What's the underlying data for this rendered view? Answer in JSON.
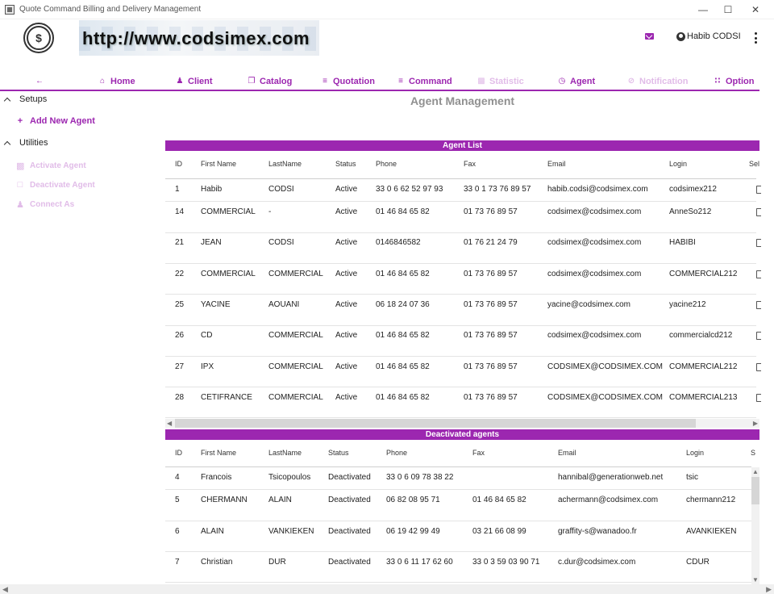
{
  "window": {
    "title": "Quote Command Billing and Delivery Management",
    "minimize": "—",
    "maximize": "☐",
    "close": "✕"
  },
  "header": {
    "banner_text": "http://www.codsimex.com",
    "user_name": "Habib CODSI",
    "logo_text": "$"
  },
  "nav": {
    "items": [
      {
        "label": "",
        "icon": "arrow-left-icon",
        "disabled": false
      },
      {
        "label": "Home",
        "icon": "home-icon",
        "disabled": false
      },
      {
        "label": "Client",
        "icon": "people-icon",
        "disabled": false
      },
      {
        "label": "Catalog",
        "icon": "catalog-icon",
        "disabled": false
      },
      {
        "label": "Quotation",
        "icon": "list-icon",
        "disabled": false
      },
      {
        "label": "Command",
        "icon": "list-icon",
        "disabled": false
      },
      {
        "label": "Statistic",
        "icon": "bar-chart-icon",
        "disabled": true
      },
      {
        "label": "Agent",
        "icon": "alarm-clock-icon",
        "disabled": false
      },
      {
        "label": "Notification",
        "icon": "bell-off-icon",
        "disabled": true
      },
      {
        "label": "Option",
        "icon": "grid-icon",
        "disabled": false
      }
    ]
  },
  "sidebar": {
    "setups_label": "Setups",
    "add_agent_label": "Add New Agent",
    "utilities_label": "Utilities",
    "activate_label": "Activate Agent",
    "deactivate_label": "Deactivate Agent",
    "connect_label": "Connect As"
  },
  "main": {
    "title": "Agent Management"
  },
  "agent_list": {
    "title": "Agent List",
    "columns": [
      "ID",
      "First Name",
      "LastName",
      "Status",
      "Phone",
      "Fax",
      "Email",
      "Login",
      "Sel"
    ],
    "rows": [
      [
        "1",
        "Habib",
        "CODSI",
        "Active",
        "33  0 6 62 52 97 93",
        "33  0 1 73 76 89 57",
        "habib.codsi@codsimex.com",
        "codsimex212"
      ],
      [
        "14",
        "COMMERCIAL",
        "-",
        "Active",
        "01 46 84 65 82",
        "01 73 76 89 57",
        "codsimex@codsimex.com",
        "AnneSo212"
      ],
      [
        "21",
        "JEAN",
        "CODSI",
        "Active",
        "0146846582",
        "01 76 21 24 79",
        "codsimex@codsimex.com",
        "HABIBI"
      ],
      [
        "22",
        "COMMERCIAL",
        "COMMERCIAL",
        "Active",
        "01 46 84 65 82",
        "01 73 76 89 57",
        "codsimex@codsimex.com",
        "COMMERCIAL212"
      ],
      [
        "25",
        "YACINE",
        "AOUANI",
        "Active",
        "06 18 24 07 36",
        "01 73 76 89 57",
        "yacine@codsimex.com",
        "yacine212"
      ],
      [
        "26",
        "CD",
        "COMMERCIAL",
        "Active",
        "01 46 84 65 82",
        "01 73 76 89 57",
        "codsimex@codsimex.com",
        "commercialcd212"
      ],
      [
        "27",
        "IPX",
        "COMMERCIAL",
        "Active",
        "01 46 84 65 82",
        "01 73 76 89 57",
        "CODSIMEX@CODSIMEX.COM",
        "COMMERCIAL212"
      ],
      [
        "28",
        "CETIFRANCE",
        "COMMERCIAL",
        "Active",
        "01 46 84 65 82",
        "01 73 76 89 57",
        "CODSIMEX@CODSIMEX.COM",
        "COMMERCIAL213"
      ]
    ]
  },
  "deactivated_list": {
    "title": "Deactivated agents",
    "columns": [
      "ID",
      "First Name",
      "LastName",
      "Status",
      "Phone",
      "Fax",
      "Email",
      "Login",
      "S"
    ],
    "rows": [
      [
        "4",
        "Francois",
        "Tsicopoulos",
        "Deactivated",
        "33  0 6 09 78 38 22",
        "",
        "hannibal@generationweb.net",
        "tsic"
      ],
      [
        "5",
        "CHERMANN",
        "ALAIN",
        "Deactivated",
        "06 82 08 95 71",
        "01 46 84 65 82",
        "achermann@codsimex.com",
        "chermann212"
      ],
      [
        "6",
        "ALAIN",
        "VANKIEKEN",
        "Deactivated",
        "06 19 42 99 49",
        "03 21 66 08 99",
        "graffity-s@wanadoo.fr",
        "AVANKIEKEN"
      ],
      [
        "7",
        "Christian",
        "DUR",
        "Deactivated",
        "33  0 6 11 17 62 60",
        "33  0 3 59 03 90 71",
        "c.dur@codsimex.com",
        "CDUR"
      ]
    ]
  },
  "colors": {
    "accent": "#9c27b0",
    "disabled": "#e1bce8",
    "title_gray": "#909090"
  }
}
